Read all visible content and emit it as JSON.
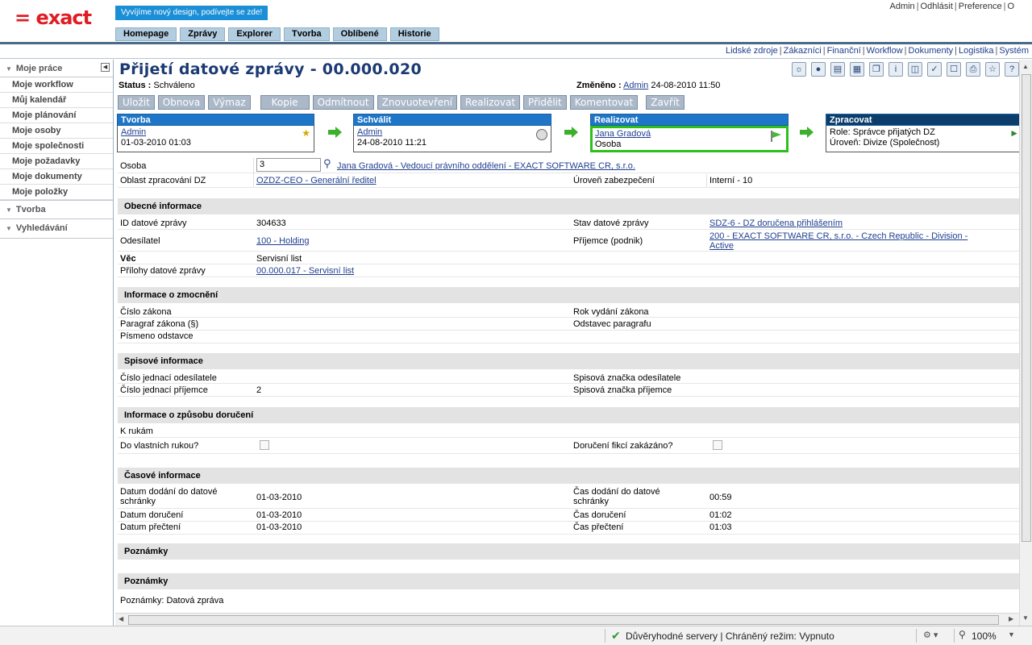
{
  "header": {
    "logo": "= exact",
    "banner": "Vyvíjíme nový design, podívejte se zde!",
    "nav": [
      "Homepage",
      "Zprávy",
      "Explorer",
      "Tvorba",
      "Oblíbené",
      "Historie"
    ],
    "user_links": [
      "Admin",
      "Odhlásit",
      "Preference",
      "O"
    ]
  },
  "modules": [
    "Lidské zdroje",
    "Zákazníci",
    "Finanční",
    "Workflow",
    "Dokumenty",
    "Logistika",
    "Systém"
  ],
  "sidebar": {
    "section1": "Moje práce",
    "items": [
      "Moje workflow",
      "Můj kalendář",
      "Moje plánování",
      "Moje osoby",
      "Moje společnosti",
      "Moje požadavky",
      "Moje dokumenty",
      "Moje položky"
    ],
    "section2": "Tvorba",
    "section3": "Vyhledávání"
  },
  "page": {
    "title": "Přijetí datové zprávy - 00.000.020",
    "status_label": "Status :",
    "status_value": "Schváleno",
    "changed_label": "Změněno :",
    "changed_user": "Admin",
    "changed_date": "24-08-2010 11:50"
  },
  "buttons": [
    "Uložit",
    "Obnova",
    "Výmaz",
    "Kopie",
    "Odmítnout",
    "Znovuotevření",
    "Realizovat",
    "Přidělit",
    "Komentovat",
    "Zavřít"
  ],
  "workflow": [
    {
      "head": "Tvorba",
      "line1": "Admin",
      "line2": "01-03-2010 01:03"
    },
    {
      "head": "Schválit",
      "line1": "Admin",
      "line2": "24-08-2010 11:21"
    },
    {
      "head": "Realizovat",
      "line1": "Jana Gradová",
      "line2": "Osoba"
    },
    {
      "head": "Zpracovat",
      "line1": "Role: Správce přijatých DZ",
      "line2": "Úroveň: Divize (Společnost)"
    }
  ],
  "form": {
    "osoba_label": "Osoba",
    "osoba_value": "3",
    "osoba_link": "Jana Gradová - Vedoucí právního oddělení - EXACT SOFTWARE CR, s.r.o.",
    "oblast_label": "Oblast zpracování DZ",
    "oblast_value": "OZDZ-CEO - Generální ředitel",
    "uroven_label": "Úroveň zabezpečení",
    "uroven_value": "Interní - 10",
    "sec_obecne": "Obecné informace",
    "id_label": "ID datové zprávy",
    "id_value": "304633",
    "stav_label": "Stav datové zprávy",
    "stav_value": "SDZ-6 - DZ doručena přihlášením",
    "odesilatel_label": "Odesílatel",
    "odesilatel_value": "100 - Holding",
    "prijemce_label": "Příjemce (podnik)",
    "prijemce_value_1": "200 - EXACT SOFTWARE CR, s.r.o. - Czech Republic - Division -",
    "prijemce_value_2": "Active",
    "vec_label": "Věc",
    "vec_value": "Servisní list",
    "prilohy_label": "Přílohy datové zprávy",
    "prilohy_value": "00.000.017 - Servisní list",
    "sec_zmocneni": "Informace o zmocnění",
    "cislo_zakona": "Číslo zákona",
    "rok_vydani": "Rok vydání zákona",
    "paragraf": "Paragraf zákona (§)",
    "odstavec": "Odstavec paragrafu",
    "pismeno": "Písmeno odstavce",
    "sec_spisove": "Spisové informace",
    "cj_odesilatele": "Číslo jednací odesílatele",
    "sz_odesilatele": "Spisová značka odesílatele",
    "cj_prijemce": "Číslo jednací příjemce",
    "cj_prijemce_value": "2",
    "sz_prijemce": "Spisová značka příjemce",
    "sec_doruceni": "Informace o způsobu doručení",
    "k_rukam": "K rukám",
    "vlastni_rukou": "Do vlastních rukou?",
    "fikce": "Doručení fikcí zakázáno?",
    "sec_casove": "Časové informace",
    "datum_dodani_1": "Datum dodání do datové",
    "datum_dodani_2": "schránky",
    "datum_dodani_value": "01-03-2010",
    "cas_dodani_1": "Čas dodání do datové",
    "cas_dodani_2": "schránky",
    "cas_dodani_value": "00:59",
    "datum_doruceni": "Datum doručení",
    "datum_doruceni_value": "01-03-2010",
    "cas_doruceni": "Čas doručení",
    "cas_doruceni_value": "01:02",
    "datum_precteni": "Datum přečtení",
    "datum_precteni_value": "01-03-2010",
    "cas_precteni": "Čas přečtení",
    "cas_precteni_value": "01:03",
    "sec_poznamky1": "Poznámky",
    "sec_poznamky2": "Poznámky",
    "poznamky_text": "Poznámky: Datová zpráva"
  },
  "statusbar": {
    "trust": "Důvěryhodné servery | Chráněný režim: Vypnuto",
    "zoom": "100%"
  },
  "colors": {
    "brand": "#e01c24",
    "title": "#1b3a73",
    "wf_head": "#1e76c8",
    "highlight": "#2ec01a"
  }
}
